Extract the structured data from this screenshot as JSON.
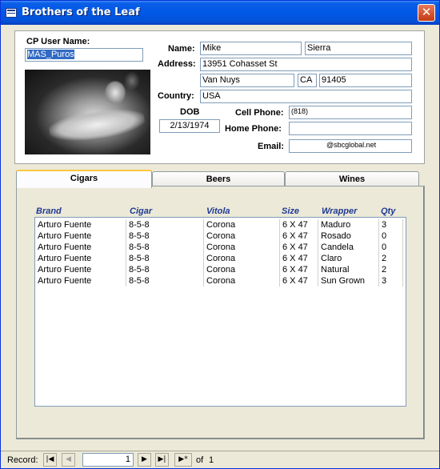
{
  "window": {
    "title": "Brothers of the Leaf",
    "close_glyph": "✕"
  },
  "user": {
    "label": "CP User Name:",
    "value": "MAS_Puros"
  },
  "photo": {
    "name": "member-photo"
  },
  "contact": {
    "name_label": "Name:",
    "first_name": "Mike",
    "last_name": "Sierra",
    "address_label": "Address:",
    "street": "13951 Cohasset St",
    "city": "Van Nuys",
    "state": "CA",
    "zip": "91405",
    "country_label": "Country:",
    "country": "USA",
    "dob_label": "DOB",
    "dob": "2/13/1974",
    "cell_label": "Cell Phone:",
    "cell": "(818)",
    "home_label": "Home Phone:",
    "home": "",
    "email_label": "Email:",
    "email": "@sbcglobal.net"
  },
  "tabs": [
    {
      "label": "Cigars",
      "active": true
    },
    {
      "label": "Beers",
      "active": false
    },
    {
      "label": "Wines",
      "active": false
    }
  ],
  "cigars": {
    "columns": [
      "Brand",
      "Cigar",
      "Vitola",
      "Size",
      "Wrapper",
      "Qty"
    ],
    "rows": [
      [
        "Arturo Fuente",
        "8-5-8",
        "Corona",
        "6 X 47",
        "Maduro",
        "3"
      ],
      [
        "Arturo Fuente",
        "8-5-8",
        "Corona",
        "6 X 47",
        "Rosado",
        "0"
      ],
      [
        "Arturo Fuente",
        "8-5-8",
        "Corona",
        "6 X 47",
        "Candela",
        "0"
      ],
      [
        "Arturo Fuente",
        "8-5-8",
        "Corona",
        "6 X 47",
        "Claro",
        "2"
      ],
      [
        "Arturo Fuente",
        "8-5-8",
        "Corona",
        "6 X 47",
        "Natural",
        "2"
      ],
      [
        "Arturo Fuente",
        "8-5-8",
        "Corona",
        "6 X 47",
        "Sun Grown",
        "3"
      ]
    ]
  },
  "record_nav": {
    "label": "Record:",
    "current": "1",
    "of_label": "of",
    "total": "1",
    "first_glyph": "|◀",
    "prev_glyph": "◀",
    "next_glyph": "▶",
    "last_glyph": "▶|",
    "new_glyph": "▶*"
  },
  "colors": {
    "titlebar": "#0058e6",
    "column_header": "#1f3a93",
    "tab_highlight": "#ffc83c",
    "selection": "#316ac5"
  }
}
